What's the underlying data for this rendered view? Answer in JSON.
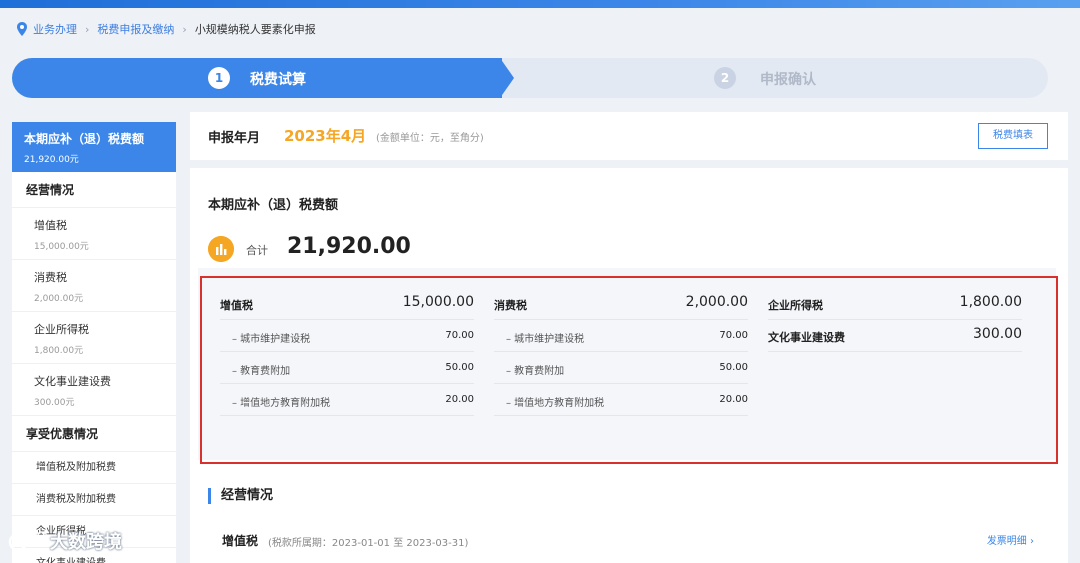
{
  "breadcrumb": {
    "items": [
      "业务办理",
      "税费申报及缴纳"
    ],
    "current": "小规模纳税人要素化申报"
  },
  "steps": [
    {
      "num": "1",
      "label": "税费试算"
    },
    {
      "num": "2",
      "label": "申报确认"
    }
  ],
  "sidebar": {
    "active": {
      "title": "本期应补（退）税费额",
      "amount": "21,920.00元"
    },
    "section1": "经营情况",
    "items": [
      {
        "label": "增值税",
        "amount": "15,000.00元"
      },
      {
        "label": "消费税",
        "amount": "2,000.00元"
      },
      {
        "label": "企业所得税",
        "amount": "1,800.00元"
      },
      {
        "label": "文化事业建设费",
        "amount": "300.00元"
      }
    ],
    "section2": "享受优惠情况",
    "subitems": [
      "增值税及附加税费",
      "消费税及附加税费",
      "企业所得税",
      "文化事业建设费"
    ]
  },
  "period": {
    "label": "申报年月",
    "value": "2023年4月",
    "note": "(金额单位：元，至角分)",
    "view_button": "税费填表"
  },
  "summary": {
    "title": "本期应补（退）税费额",
    "total_label": "合计",
    "total_value": "21,920.00"
  },
  "detail": {
    "col1": [
      {
        "label": "增值税",
        "value": "15,000.00"
      },
      {
        "label": "– 城市维护建设税",
        "value": "70.00"
      },
      {
        "label": "– 教育费附加",
        "value": "50.00"
      },
      {
        "label": "– 增值地方教育附加税",
        "value": "20.00"
      }
    ],
    "col2": [
      {
        "label": "消费税",
        "value": "2,000.00"
      },
      {
        "label": "– 城市维护建设税",
        "value": "70.00"
      },
      {
        "label": "– 教育费附加",
        "value": "50.00"
      },
      {
        "label": "– 增值地方教育附加税",
        "value": "20.00"
      }
    ],
    "col3": [
      {
        "label": "企业所得税",
        "value": "1,800.00"
      },
      {
        "label": "文化事业建设费",
        "value": "300.00"
      }
    ]
  },
  "business": {
    "section_title": "经营情况",
    "vat_label": "增值税",
    "vat_period": "(税款所属期：2023-01-01 至 2023-03-31)",
    "invoice_link": "发票明细 ›"
  },
  "watermark": {
    "text": "大数跨境"
  },
  "colors": {
    "accent": "#3b86e8",
    "highlight": "#f5a623",
    "frame": "#d8302c"
  }
}
